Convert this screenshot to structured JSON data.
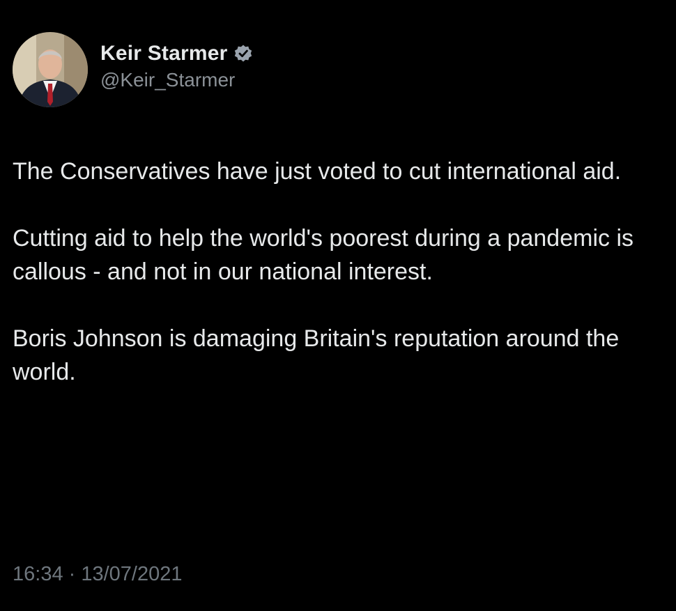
{
  "tweet": {
    "author": {
      "display_name": "Keir Starmer",
      "handle": "@Keir_Starmer",
      "verified_icon": "verified-badge-icon",
      "avatar": "profile-photo"
    },
    "paragraphs": [
      "The Conservatives have just voted to cut international aid.",
      "Cutting aid to help the world's poorest during a pandemic is callous - and not in our national interest.",
      "Boris Johnson is damaging Britain's reputation around the world."
    ],
    "timestamp": "16:34 · 13/07/2021"
  },
  "colors": {
    "background": "#000000",
    "primary_text": "#e7e9ea",
    "secondary_text": "#8b9197",
    "timestamp_text": "#6e767d",
    "verified_badge": "#9aa3ad"
  }
}
